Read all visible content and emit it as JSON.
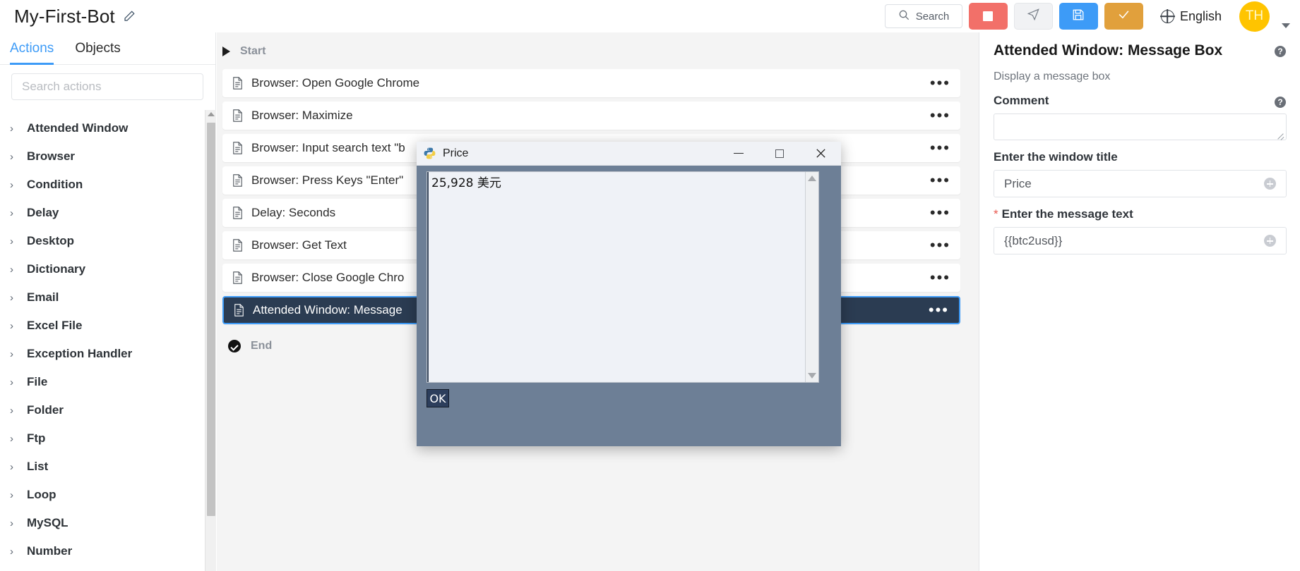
{
  "topbar": {
    "bot_name": "My-First-Bot",
    "edit_icon": "pencil-icon",
    "search_label": "Search",
    "search_icon": "search-icon",
    "stop_button": "stop-button",
    "run_button": "run-button",
    "save_button": "save-button",
    "check_button": "check-button",
    "language": "English",
    "language_icon": "globe-icon",
    "avatar_initials": "TH",
    "colors": {
      "stop": "#f27069",
      "run": "#f1f2f4",
      "save": "#3d9bf7",
      "check": "#e1a03c",
      "avatar": "#ffc400",
      "accent": "#3d9bf7"
    }
  },
  "left_panel": {
    "tabs": [
      {
        "label": "Actions",
        "active": true
      },
      {
        "label": "Objects",
        "active": false
      }
    ],
    "search_placeholder": "Search actions",
    "categories": [
      "Attended Window",
      "Browser",
      "Condition",
      "Delay",
      "Desktop",
      "Dictionary",
      "Email",
      "Excel File",
      "Exception Handler",
      "File",
      "Folder",
      "Ftp",
      "List",
      "Loop",
      "MySQL",
      "Number"
    ]
  },
  "canvas": {
    "start_label": "Start",
    "end_label": "End",
    "steps": [
      {
        "label": "Browser: Open Google Chrome",
        "selected": false
      },
      {
        "label": "Browser: Maximize",
        "selected": false
      },
      {
        "label": "Browser: Input search text \"b",
        "selected": false
      },
      {
        "label": "Browser: Press Keys \"Enter\"",
        "selected": false
      },
      {
        "label": "Delay: Seconds",
        "selected": false
      },
      {
        "label": "Browser: Get Text",
        "selected": false
      },
      {
        "label": "Browser: Close Google Chro",
        "selected": false
      },
      {
        "label": "Attended Window: Message",
        "selected": true
      }
    ],
    "row_menu": "•••"
  },
  "right_panel": {
    "title": "Attended Window: Message Box",
    "subtitle": "Display a message box",
    "comment_label": "Comment",
    "comment_value": "",
    "window_title_label": "Enter the window title",
    "window_title_value": "Price",
    "message_text_label": "Enter the message text",
    "message_text_value": "{{btc2usd}}",
    "required_marker": "*",
    "help_icon": "help-circle-icon",
    "add_icon": "plus-circle-icon"
  },
  "dialog": {
    "title": "Price",
    "app_icon": "python-logo-icon",
    "minimize_icon": "minimize-icon",
    "maximize_icon": "maximize-icon",
    "close_icon": "close-icon",
    "body_text": "25,928 美元",
    "ok_label": "OK",
    "bg_color": "#6d7f96"
  }
}
